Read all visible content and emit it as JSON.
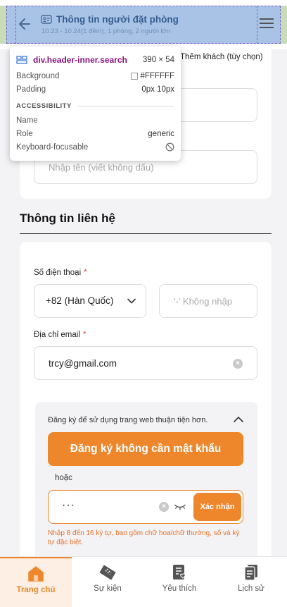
{
  "header": {
    "title": "Thông tin người đặt phòng",
    "subtitle": "10.23 - 10.24(1 đêm), 1 phòng, 2 người lớn"
  },
  "guest_card": {
    "add_guest_label": "Thêm khách (tùy chọn)",
    "name_placeholder": "Nhập tên (viết không dấu)"
  },
  "inspector": {
    "selector": "div.header-inner.search",
    "dimensions": "390 × 54",
    "background_label": "Background",
    "background_value": "#FFFFFF",
    "padding_label": "Padding",
    "padding_value": "0px 10px",
    "section_title": "ACCESSIBILITY",
    "name_label": "Name",
    "name_value": "",
    "role_label": "Role",
    "role_value": "generic",
    "focusable_label": "Keyboard-focusable"
  },
  "contact": {
    "section_title": "Thông tin liên hệ",
    "phone_label": "Số điện thoại",
    "required_mark": "*",
    "country_code": "+82 (Hàn Quốc)",
    "phone_placeholder": "'-' Không nhập",
    "email_label": "Địa chỉ email",
    "email_value": "trcy@gmail.com"
  },
  "register": {
    "prompt": "Đăng ký để sử dụng trang web thuận tiện hơn.",
    "button_label": "Đăng ký không cần mật khẩu",
    "or_text": "hoặc",
    "password_mask": "···",
    "confirm_label": "Xác nhận",
    "hint": "Nhập 8 đến 16 ký tự, bao gồm chữ hoa/chữ thường, số và ký tự đặc biệt."
  },
  "bottom_nav": {
    "items": [
      {
        "label": "Trang chủ",
        "icon": "home-icon",
        "active": true
      },
      {
        "label": "Sự kiện",
        "icon": "ticket-icon",
        "active": false
      },
      {
        "label": "Yêu thích",
        "icon": "favorite-list-icon",
        "active": false
      },
      {
        "label": "Lịch sử",
        "icon": "history-icon",
        "active": false
      }
    ]
  },
  "colors": {
    "accent": "#EE862B",
    "error": "#E24B4B",
    "header_highlight": "#A9C3E6"
  }
}
